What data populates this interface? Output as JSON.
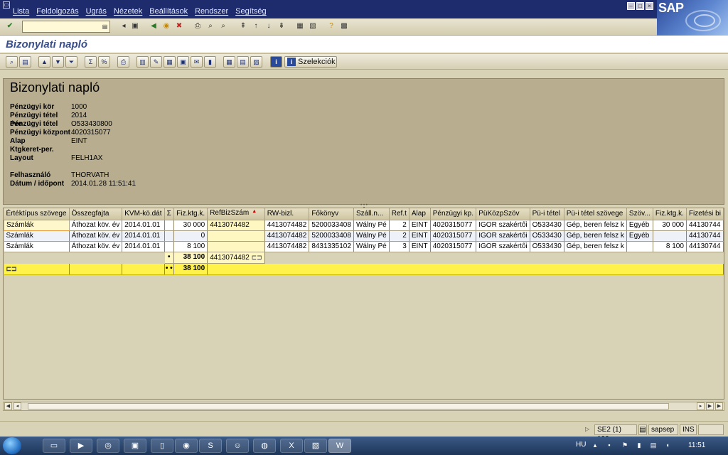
{
  "menu": {
    "items": [
      "Lista",
      "Feldolgozás",
      "Ugrás",
      "Nézetek",
      "Beállítások",
      "Rendszer",
      "Segítség"
    ],
    "logo": "SAP"
  },
  "command_field": {
    "value": ""
  },
  "title": "Bizonylati napló",
  "app_toolbar": {
    "selections_label": "Szelekciók"
  },
  "header": {
    "title": "Bizonylati napló",
    "fields": [
      {
        "label": "Pénzügyi kör",
        "value": "1000"
      },
      {
        "label": "Pénzügyi tétel éve",
        "value": "2014"
      },
      {
        "label": "Pénzügyi tétel",
        "value": "O533430800"
      },
      {
        "label": "Pénzügyi központ",
        "value": "4020315077"
      },
      {
        "label": "Alap",
        "value": "EINT"
      },
      {
        "label": "Ktgkeret-per.",
        "value": ""
      },
      {
        "label": "Layout",
        "value": "FELH1AX"
      }
    ],
    "user_fields": [
      {
        "label": "Felhasználó",
        "value": "THORVATH"
      },
      {
        "label": "Dátum / időpont",
        "value": "2014.01.28 11:51:41"
      }
    ]
  },
  "grid": {
    "columns": [
      "Értéktípus szövege",
      "Összegfajta",
      "KVM-kö.dát",
      "Σ",
      "Fiz.ktg.k.",
      "RefBizSzám",
      "RW-bizl.",
      "Főkönyv",
      "Száll.n...",
      "Ref.t",
      "Alap",
      "Pénzügyi kp.",
      "PüKözpSzöv",
      "Pü-i tétel",
      "Pü-i tétel szövege",
      "Szöv...",
      "Fiz.ktg.k.",
      "Fizetési bi"
    ],
    "rows": [
      [
        "Számlák",
        "Áthozat köv. év",
        "2014.01.01",
        "",
        "30 000",
        "4413074482",
        "4413074482",
        "5200033408",
        "Wálny Pé",
        "2",
        "EINT",
        "4020315077",
        "IGOR szakértői",
        "O533430",
        "Gép, beren felsz k",
        "Egyéb",
        "30 000",
        "44130744"
      ],
      [
        "Számlák",
        "Áthozat köv. év",
        "2014.01.01",
        "",
        "0",
        "",
        "4413074482",
        "5200033408",
        "Wálny Pé",
        "2",
        "EINT",
        "4020315077",
        "IGOR szakértői",
        "O533430",
        "Gép, beren felsz k",
        "Egyéb",
        "",
        "44130744"
      ],
      [
        "Számlák",
        "Áthozat köv. év",
        "2014.01.01",
        "",
        "8 100",
        "",
        "4413074482",
        "8431335102",
        "Wálny Pé",
        "3",
        "EINT",
        "4020315077",
        "IGOR szakértői",
        "O533430",
        "Gép, beren felsz k",
        "",
        "8 100",
        "44130744"
      ]
    ],
    "subtotal": {
      "marker": "•",
      "value": "38 100",
      "ref": "4413074482"
    },
    "total": {
      "marker": "• •",
      "value": "38 100"
    }
  },
  "status": {
    "system": "SE2 (1) 100",
    "server": "sapsep",
    "mode": "INS"
  },
  "taskbar": {
    "lang": "HU",
    "clock": "11:51"
  }
}
